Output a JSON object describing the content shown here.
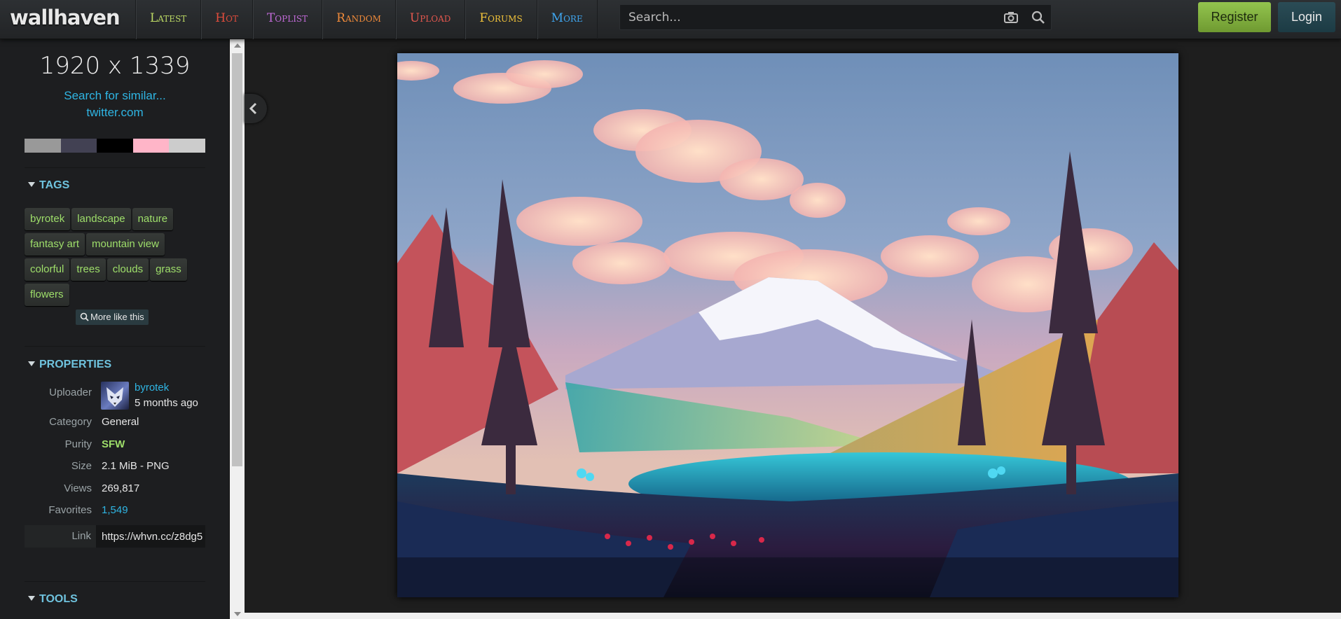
{
  "header": {
    "logo": "wallhaven",
    "nav": [
      {
        "label": "Latest",
        "color": "#bcd964"
      },
      {
        "label": "Hot",
        "color": "#e04c3c"
      },
      {
        "label": "Toplist",
        "color": "#c06ad6"
      },
      {
        "label": "Random",
        "color": "#ef8a3a"
      },
      {
        "label": "Upload",
        "color": "#e3574e"
      },
      {
        "label": "Forums",
        "color": "#f2c33a"
      },
      {
        "label": "More",
        "color": "#3fa6f0"
      }
    ],
    "search_placeholder": "Search...",
    "register_label": "Register",
    "login_label": "Login"
  },
  "sidebar": {
    "resolution": "1920 x 1339",
    "similar_link": "Search for similar...",
    "source_link": "twitter.com",
    "palette": [
      "#999999",
      "#424153",
      "#000000",
      "#ffb5c8",
      "#cccccc"
    ],
    "tags_title": "TAGS",
    "tags": [
      "byrotek",
      "landscape",
      "nature",
      "fantasy art",
      "mountain view",
      "colorful",
      "trees",
      "clouds",
      "grass",
      "flowers"
    ],
    "more_like_label": "More like this",
    "properties_title": "PROPERTIES",
    "properties": {
      "uploader_label": "Uploader",
      "uploader_name": "byrotek",
      "uploaded_ago": "5 months ago",
      "category_label": "Category",
      "category_value": "General",
      "purity_label": "Purity",
      "purity_value": "SFW",
      "size_label": "Size",
      "size_value": "2.1 MiB - PNG",
      "views_label": "Views",
      "views_value": "269,817",
      "favorites_label": "Favorites",
      "favorites_value": "1,549",
      "link_label": "Link",
      "link_value": "https://whvn.cc/z8dg5"
    },
    "tools_title": "TOOLS"
  }
}
